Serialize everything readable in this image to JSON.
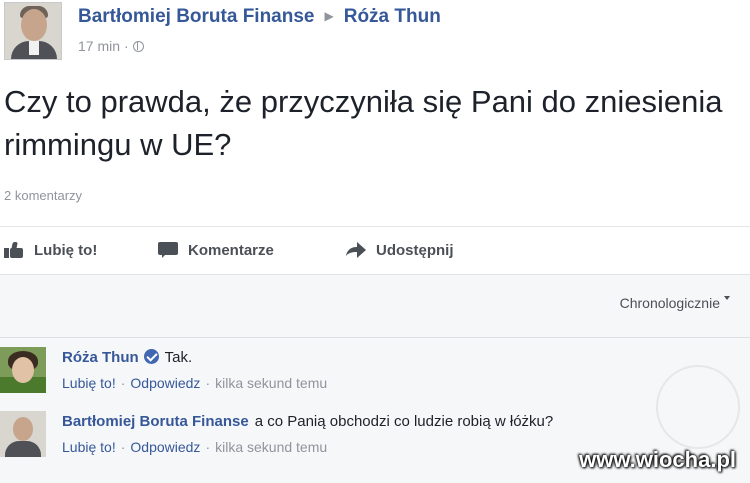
{
  "post": {
    "author": "Bartłomiej Boruta Finanse",
    "target": "Róża Thun",
    "time": "17 min",
    "text": "Czy to prawda, że przyczyniła się Pani do zniesienia rimmingu w UE?",
    "comment_count": "2 komentarzy"
  },
  "actions": {
    "like": "Lubię to!",
    "comment": "Komentarze",
    "share": "Udostępnij"
  },
  "comments_section": {
    "sort_label": "Chronologicznie",
    "comments": [
      {
        "author": "Róża Thun",
        "text": "Tak.",
        "like": "Lubię to!",
        "reply": "Odpowiedz",
        "time": "kilka sekund temu"
      },
      {
        "author": "Bartłomiej Boruta Finanse",
        "text": "a co Panią obchodzi co ludzie robią w łóżku?",
        "like": "Lubię to!",
        "reply": "Odpowiedz",
        "time": "kilka sekund temu"
      }
    ]
  },
  "watermark": "www.wiocha.pl",
  "colors": {
    "link": "#365899",
    "meta": "#90949c",
    "text": "#1d2129",
    "verified": "#4267b2",
    "comments_bg": "#f6f7f9"
  },
  "icons": {
    "like": "thumbs-up-icon",
    "comment": "comment-bubble-icon",
    "share": "share-arrow-icon",
    "privacy": "globe-icon",
    "verified": "verified-badge-icon"
  }
}
